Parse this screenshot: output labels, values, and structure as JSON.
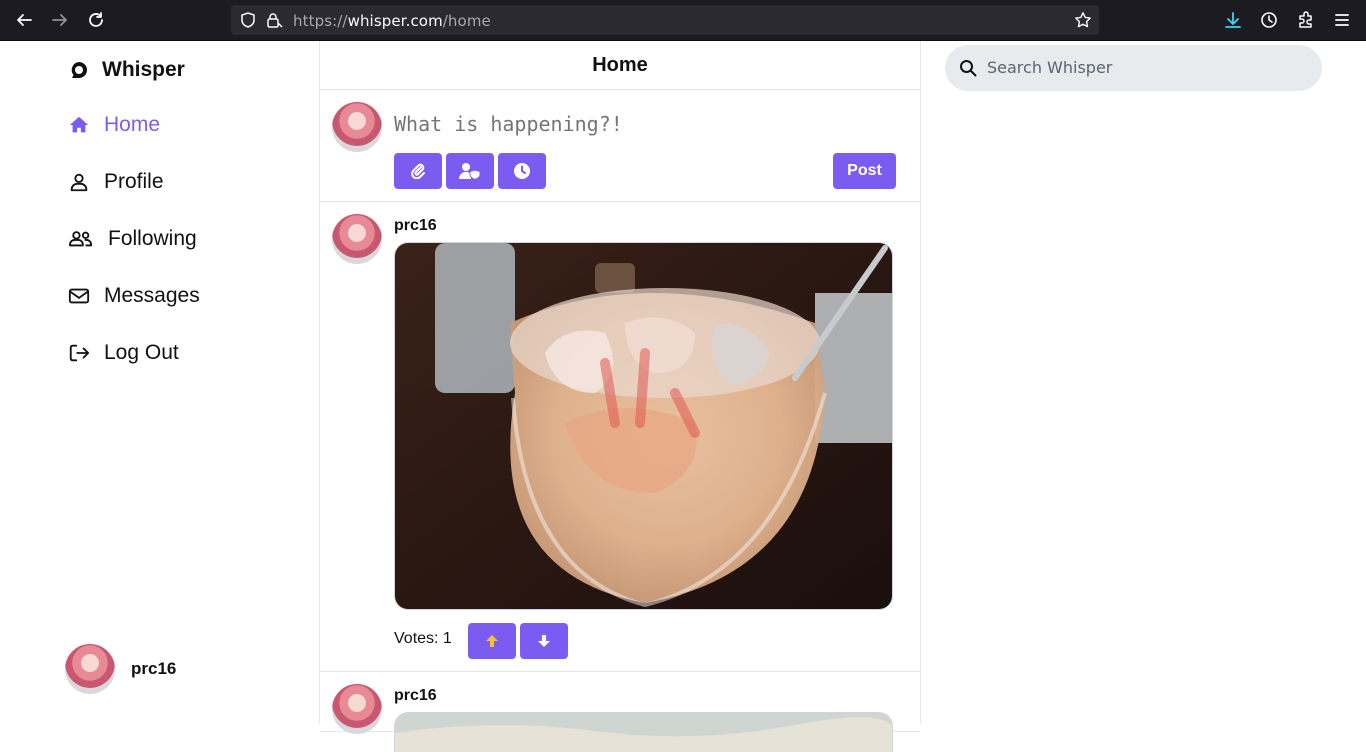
{
  "browser": {
    "url_prefix": "https://",
    "url_host": "whisper.com",
    "url_path": "/home"
  },
  "app": {
    "brand": "Whisper",
    "accent": "#7c5cf0",
    "nav": [
      {
        "label": "Home",
        "icon": "home-icon",
        "active": true
      },
      {
        "label": "Profile",
        "icon": "user-icon"
      },
      {
        "label": "Following",
        "icon": "users-icon"
      },
      {
        "label": "Messages",
        "icon": "envelope-icon"
      },
      {
        "label": "Log Out",
        "icon": "logout-icon"
      }
    ],
    "current_user": "prc16"
  },
  "main": {
    "title": "Home",
    "composer": {
      "placeholder": "What is happening?!",
      "post_label": "Post",
      "tools": [
        "paperclip-icon",
        "user-shield-icon",
        "clock-icon"
      ]
    },
    "posts": [
      {
        "author": "prc16",
        "votes_label": "Votes: 1",
        "image": "iced-drink-photo"
      },
      {
        "author": "prc16",
        "image": "sky-photo"
      }
    ]
  },
  "search": {
    "placeholder": "Search Whisper"
  }
}
